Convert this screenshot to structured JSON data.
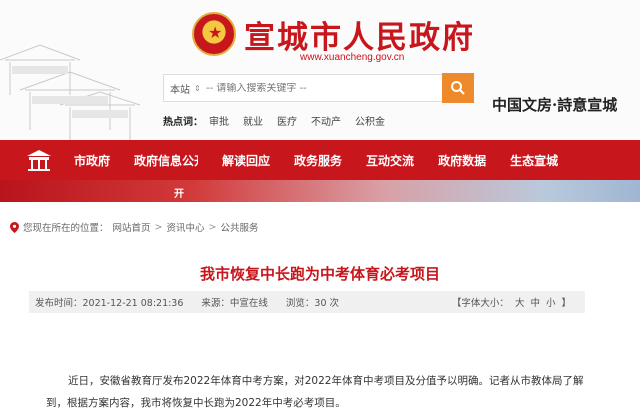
{
  "header": {
    "title": "宣城市人民政府",
    "url": "www.xuancheng.gov.cn",
    "slogan": "中国文房·詩意宣城",
    "search": {
      "scope": "本站",
      "placeholder": "-- 请输入搜索关键字 --",
      "button_icon": "search-icon"
    },
    "hot": {
      "label": "热点词：",
      "items": [
        "审批",
        "就业",
        "医疗",
        "不动产",
        "公积金"
      ]
    }
  },
  "nav": {
    "items": [
      "市政府",
      "政府信息公开",
      "解读回应",
      "政务服务",
      "互动交流",
      "政府数据",
      "生态宣城"
    ]
  },
  "banner": {
    "overflow_char": "开"
  },
  "breadcrumb": {
    "prefix": "您现在所在的位置：",
    "items": [
      "网站首页",
      "资讯中心",
      "公共服务"
    ],
    "separator": ">"
  },
  "article": {
    "title": "我市恢复中长跑为中考体育必考项目",
    "meta": {
      "time": "发布时间：2021-12-21 08:21:36",
      "source": "来源：中宣在线",
      "views": "浏览：30 次",
      "fontsize_label": "【字体大小：",
      "large": "大",
      "medium": "中",
      "small": "小",
      "fontsize_end": "】"
    },
    "paragraphs": [
      "近日，安徽省教育厅发布2022年体育中考方案，对2022年体育中考项目及分值予以明确。记者从市教体局了解到，根据方案内容，我市将恢复中长跑为2022年中考必考项目。"
    ]
  },
  "colors": {
    "brand_red": "#c8161d",
    "search_orange": "#ee8a2b",
    "meta_bg": "#f0f0f0"
  }
}
